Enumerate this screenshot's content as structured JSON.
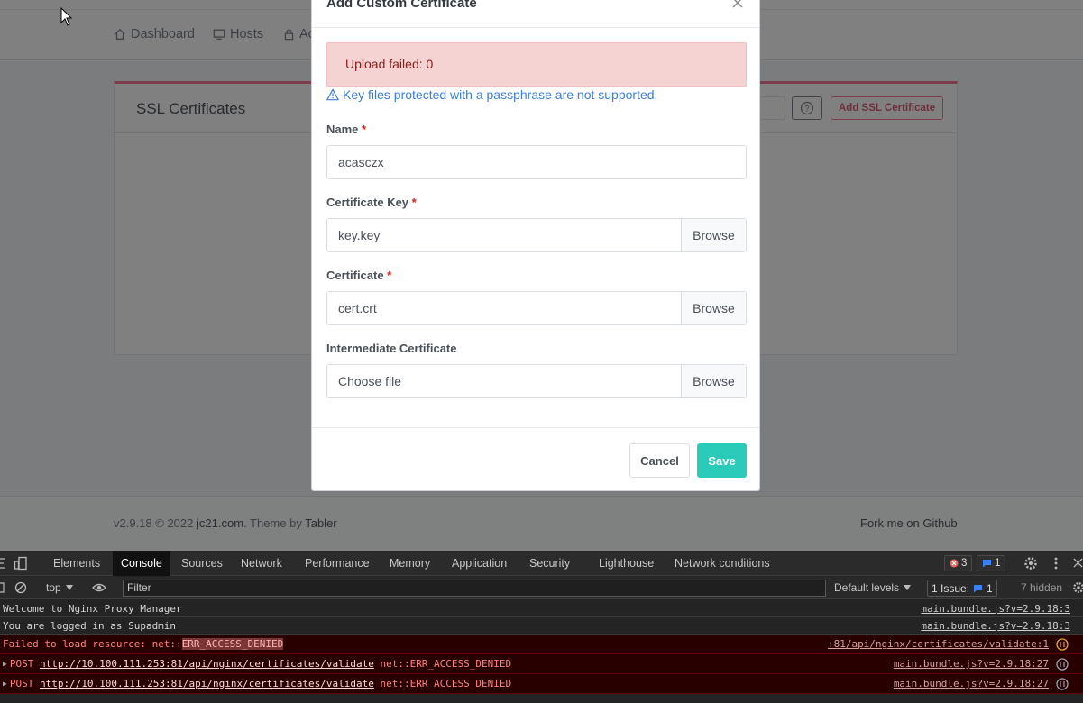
{
  "nav": {
    "dashboard": "Dashboard",
    "hosts": "Hosts",
    "access": "Ac"
  },
  "card": {
    "title": "SSL Certificates",
    "add_button": "Add SSL Certificate"
  },
  "footer": {
    "version": "v2.9.18 © 2022",
    "author_link": "jc21.com",
    "theme_text": ". Theme by",
    "theme_link": "Tabler",
    "github": "Fork me on Github"
  },
  "modal": {
    "title": "Add Custom Certificate",
    "alert": "Upload failed: 0",
    "passphrase_note": "Key files protected with a passphrase are not supported.",
    "fields": {
      "name": {
        "label": "Name",
        "value": "acasczx"
      },
      "key": {
        "label": "Certificate Key",
        "value": "key.key",
        "browse": "Browse"
      },
      "cert": {
        "label": "Certificate",
        "value": "cert.crt",
        "browse": "Browse"
      },
      "intermediate": {
        "label": "Intermediate Certificate",
        "value": "Choose file",
        "browse": "Browse"
      }
    },
    "required_mark": "*",
    "cancel": "Cancel",
    "save": "Save"
  },
  "devtools": {
    "tabs": [
      "Elements",
      "Console",
      "Sources",
      "Network",
      "Performance",
      "Memory",
      "Application",
      "Security",
      "Lighthouse",
      "Network conditions"
    ],
    "active_tab": "Console",
    "error_count": "3",
    "message_count": "1",
    "context": "top",
    "filter_placeholder": "Filter",
    "levels": "Default levels",
    "issues_label": "1 Issue:",
    "issues_count": "1",
    "hidden": "7 hidden",
    "logs": [
      {
        "text": "Welcome to Nginx Proxy Manager",
        "source": "main.bundle.js?v=2.9.18:3"
      },
      {
        "text": "You are logged in as Supadmin",
        "source": "main.bundle.js?v=2.9.18:3"
      },
      {
        "text": "Failed to load resource: net::",
        "highlight": "ERR_ACCESS_DENIED",
        "source": ":81/api/nginx/certificates/validate:1"
      },
      {
        "method": "POST",
        "url": "http://10.100.111.253:81/api/nginx/certificates/validate",
        "error": "net::ERR_ACCESS_DENIED",
        "source": "main.bundle.js?v=2.9.18:27"
      },
      {
        "method": "POST",
        "url": "http://10.100.111.253:81/api/nginx/certificates/validate",
        "error": "net::ERR_ACCESS_DENIED",
        "source": "main.bundle.js?v=2.9.18:27"
      }
    ]
  },
  "colors": {
    "accent_teal": "#2bcbba",
    "error_red": "#cd201f",
    "link_blue": "#3b7dd8"
  },
  "icons": [
    "home-icon",
    "monitor-icon",
    "lock-icon",
    "help-icon",
    "close-icon",
    "warning-icon",
    "cursor-icon"
  ]
}
